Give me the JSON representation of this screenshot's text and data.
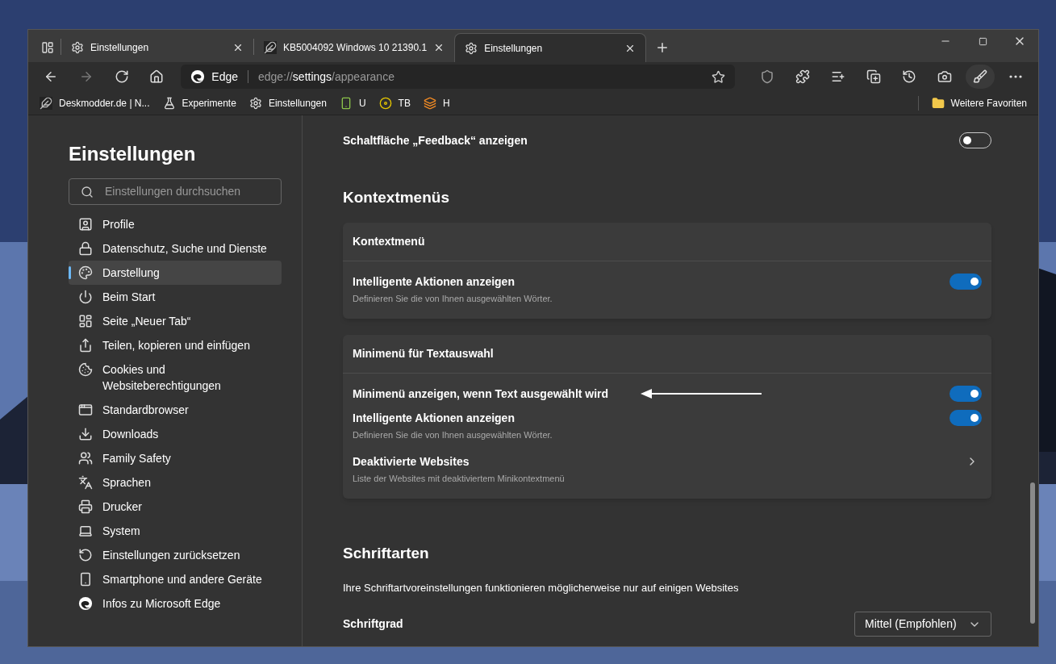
{
  "tabs": [
    {
      "kind": "settings",
      "title": "Einstellungen",
      "selected": false
    },
    {
      "kind": "site",
      "title": "KB5004092 Windows 10 21390.1",
      "selected": false
    },
    {
      "kind": "settings",
      "title": "Einstellungen",
      "selected": true
    }
  ],
  "address": {
    "brand": "Edge",
    "scheme": "edge://",
    "host": "settings",
    "path": "/appearance"
  },
  "bookmarks": [
    {
      "kind": "feather",
      "label": "Deskmodder.de | N..."
    },
    {
      "kind": "flask",
      "label": "Experimente"
    },
    {
      "kind": "settings",
      "label": "Einstellungen"
    },
    {
      "kind": "app",
      "label": "U"
    },
    {
      "kind": "disc",
      "label": "TB"
    },
    {
      "kind": "layers",
      "label": "H"
    }
  ],
  "other_favorites": "Weitere Favoriten",
  "sidebar": {
    "title": "Einstellungen",
    "search_placeholder": "Einstellungen durchsuchen",
    "items": [
      {
        "label": "Profile",
        "selected": false
      },
      {
        "label": "Datenschutz, Suche und Dienste",
        "selected": false
      },
      {
        "label": "Darstellung",
        "selected": true
      },
      {
        "label": "Beim Start",
        "selected": false
      },
      {
        "label": "Seite „Neuer Tab“",
        "selected": false
      },
      {
        "label": "Teilen, kopieren und einfügen",
        "selected": false
      },
      {
        "label": "Cookies und Websiteberechtigungen",
        "selected": false
      },
      {
        "label": "Standardbrowser",
        "selected": false
      },
      {
        "label": "Downloads",
        "selected": false
      },
      {
        "label": "Family Safety",
        "selected": false
      },
      {
        "label": "Sprachen",
        "selected": false
      },
      {
        "label": "Drucker",
        "selected": false
      },
      {
        "label": "System",
        "selected": false
      },
      {
        "label": "Einstellungen zurücksetzen",
        "selected": false
      },
      {
        "label": "Smartphone und andere Geräte",
        "selected": false
      },
      {
        "label": "Infos zu Microsoft Edge",
        "selected": false
      }
    ]
  },
  "feedback_row": {
    "label": "Schaltfläche „Feedback“ anzeigen",
    "on": false
  },
  "context_section": {
    "heading": "Kontextmenüs",
    "cards": [
      {
        "title": "Kontextmenü",
        "rows": [
          {
            "kind": "toggle",
            "label": "Intelligente Aktionen anzeigen",
            "description": "Definieren Sie die von Ihnen ausgewählten Wörter.",
            "on": true
          }
        ]
      },
      {
        "title": "Minimenü für Textauswahl",
        "rows": [
          {
            "kind": "toggle",
            "label": "Minimenü anzeigen, wenn Text ausgewählt wird",
            "on": true
          },
          {
            "kind": "toggle",
            "label": "Intelligente Aktionen anzeigen",
            "description": "Definieren Sie die von Ihnen ausgewählten Wörter.",
            "on": true
          },
          {
            "kind": "link",
            "label": "Deaktivierte Websites",
            "description": "Liste der Websites mit deaktiviertem Minikontextmenü"
          }
        ]
      }
    ]
  },
  "fonts_section": {
    "heading": "Schriftarten",
    "description": "Ihre Schriftartvoreinstellungen funktionieren möglicherweise nur auf einigen Websites",
    "size_label": "Schriftgrad",
    "size_value": "Mittel (Empfohlen)"
  }
}
